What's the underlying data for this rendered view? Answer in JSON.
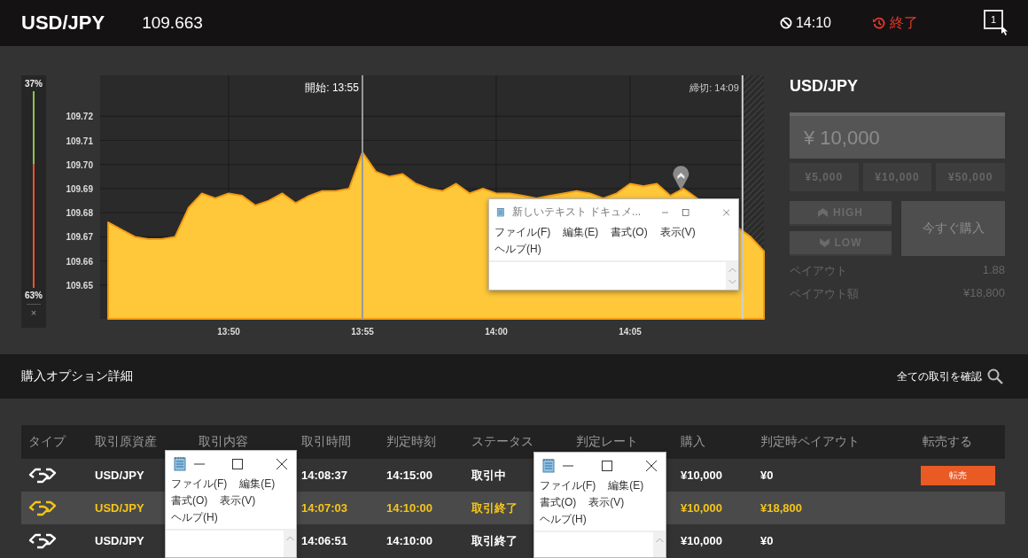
{
  "header": {
    "symbol": "USD/JPY",
    "price": "109.663",
    "expiry_time": "14:10",
    "status": "終了",
    "window_count": "1"
  },
  "sentiment": {
    "high_percent": "37%",
    "low_percent": "63%",
    "level": 0.37,
    "close": "×"
  },
  "chart": {
    "chart_data": {
      "type": "area",
      "categories": [
        null,
        null,
        null,
        null,
        null,
        null,
        null,
        null,
        null,
        "13:50",
        null,
        null,
        null,
        null,
        null,
        null,
        null,
        null,
        null,
        "13:55",
        null,
        null,
        null,
        null,
        null,
        null,
        null,
        null,
        null,
        "14:00",
        null,
        null,
        null,
        null,
        null,
        null,
        null,
        null,
        null,
        "14:05",
        null,
        null,
        null,
        null,
        null,
        null,
        null,
        null,
        null,
        null
      ],
      "series": [
        {
          "color": "#ffc83a",
          "values": [
            109.676,
            109.673,
            109.67,
            109.669,
            109.669,
            109.67,
            109.682,
            109.688,
            109.686,
            109.688,
            109.687,
            109.683,
            109.685,
            109.688,
            109.684,
            109.687,
            109.689,
            109.689,
            109.69,
            109.705,
            109.697,
            109.695,
            109.696,
            109.692,
            109.69,
            109.689,
            109.692,
            109.688,
            109.69,
            109.688,
            109.688,
            109.687,
            109.686,
            109.687,
            109.688,
            109.689,
            109.688,
            109.686,
            109.688,
            109.692,
            109.691,
            109.692,
            109.687,
            109.69,
            null,
            null,
            null,
            null,
            109.67,
            109.664
          ]
        }
      ],
      "grid": true,
      "ylim": [
        109.636,
        109.737
      ],
      "yticks": [
        109.65,
        109.66,
        109.67,
        109.68,
        109.69,
        {
          "value": 109.7,
          "label": "109.70"
        },
        109.71,
        109.72
      ],
      "annotations": [
        "開始: 13:55",
        "締切: 14:09"
      ]
    }
  },
  "trade_panel": {
    "symbol": "USD/JPY",
    "amount": "¥ 10,000",
    "presets": [
      "¥5,000",
      "¥10,000",
      "¥50,000"
    ],
    "high": "HIGH",
    "low": "LOW",
    "buy": "今すぐ購入",
    "disabled": true,
    "payout_label": "ペイアウト",
    "payout": "1.88",
    "payout_amount_label": "ペイアウト額",
    "payout_amount": "¥18,800"
  },
  "section": {
    "title": "購入オプション詳細",
    "link": "全ての取引を確認"
  },
  "table": {
    "columns": [
      "タイプ",
      "取引原資産",
      "取引内容",
      "取引時間",
      "判定時刻",
      "ステータス",
      "判定レート",
      "購入",
      "判定時ペイアウト",
      "転売する"
    ],
    "rows": [
      {
        "selected": false,
        "asset": "USD/JPY",
        "trade_time": "14:08:37",
        "expiry": "14:15:00",
        "status": "取引中",
        "purchase": "¥10,000",
        "payout": "¥0",
        "resell": "転売"
      },
      {
        "selected": true,
        "asset": "USD/JPY",
        "trade_time": "14:07:03",
        "expiry": "14:10:00",
        "status": "取引終了",
        "purchase": "¥10,000",
        "payout": "¥18,800"
      },
      {
        "selected": false,
        "asset": "USD/JPY",
        "trade_time": "14:06:51",
        "expiry": "14:10:00",
        "status": "取引終了",
        "purchase": "¥10,000",
        "payout": "¥0"
      }
    ]
  },
  "windows": [
    {
      "title": "新しいテキスト ドキュメ...",
      "menu": [
        "ファイル(F)",
        "編集(E)",
        "書式(O)",
        "表示(V)",
        "ヘルプ(H)"
      ]
    },
    {
      "menu": [
        "ファイル(F)",
        "編集(E)",
        "書式(O)",
        "表示(V)",
        "ヘルプ(H)"
      ]
    },
    {
      "menu": [
        "ファイル(F)",
        "編集(E)",
        "書式(O)",
        "表示(V)",
        "ヘルプ(H)"
      ]
    }
  ]
}
